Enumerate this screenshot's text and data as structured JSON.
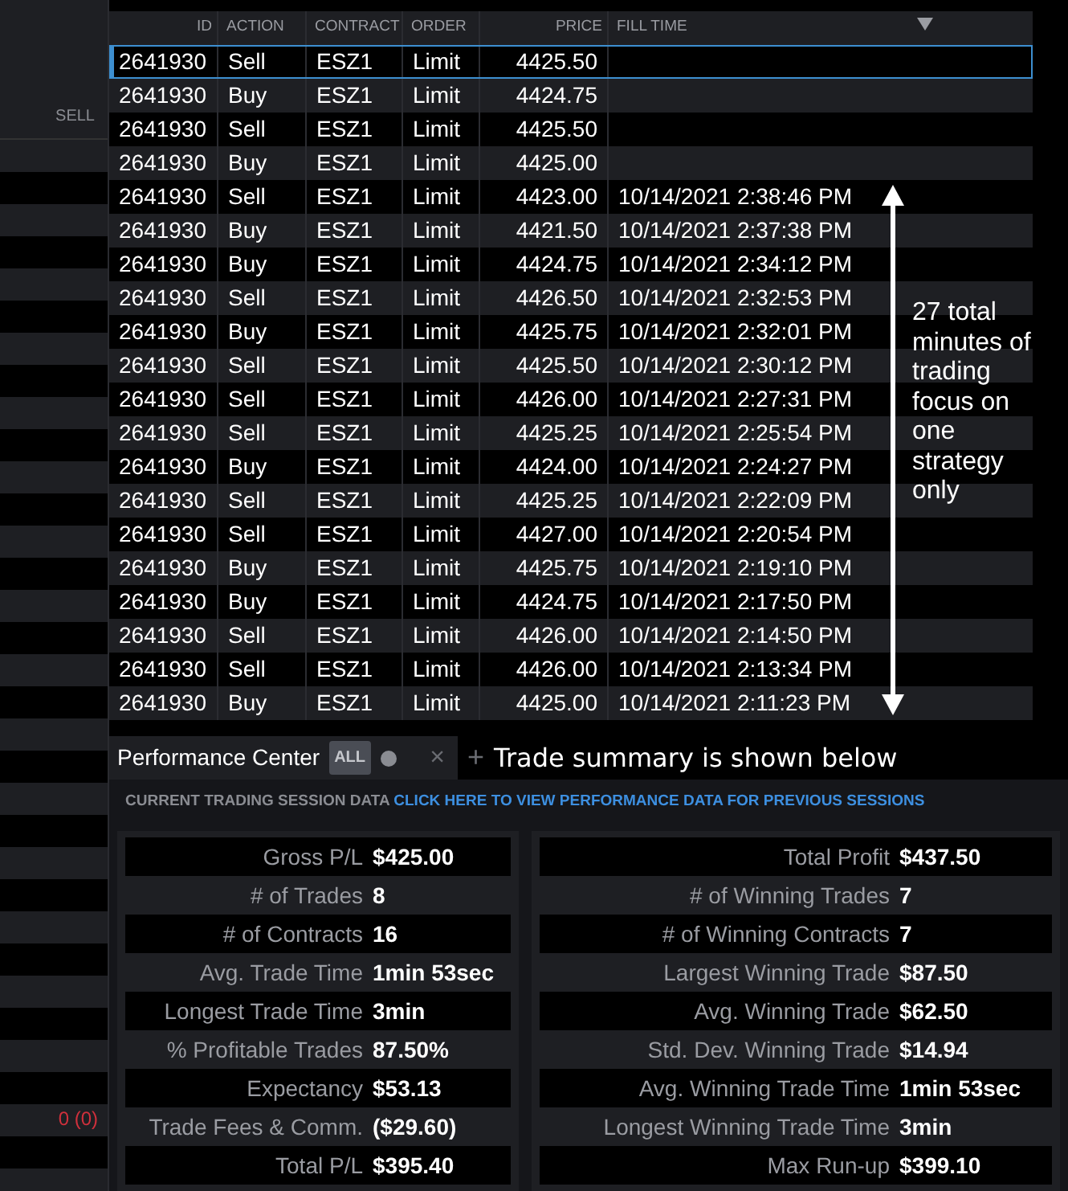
{
  "side_panel": {
    "column_label": "SELL",
    "position_value": "0 (0)"
  },
  "orders": {
    "columns": [
      "ID",
      "ACTION",
      "CONTRACT",
      "ORDER",
      "PRICE",
      "FILL TIME"
    ],
    "rows": [
      {
        "id": "2641930",
        "action": "Sell",
        "contract": "ESZ1",
        "order": "Limit",
        "price": "4425.50",
        "selected": true
      },
      {
        "id": "2641930",
        "action": "Buy",
        "contract": "ESZ1",
        "order": "Limit",
        "price": "4424.75",
        "selected": false
      },
      {
        "id": "2641930",
        "action": "Sell",
        "contract": "ESZ1",
        "order": "Limit",
        "price": "4425.50",
        "selected": false
      },
      {
        "id": "2641930",
        "action": "Buy",
        "contract": "ESZ1",
        "order": "Limit",
        "price": "4425.00",
        "selected": false
      },
      {
        "id": "2641930",
        "action": "Sell",
        "contract": "ESZ1",
        "order": "Limit",
        "price": "4423.00",
        "fill_time": "10/14/2021 2:38:46 PM",
        "selected": false
      },
      {
        "id": "2641930",
        "action": "Buy",
        "contract": "ESZ1",
        "order": "Limit",
        "price": "4421.50",
        "fill_time": "10/14/2021 2:37:38 PM",
        "selected": false
      },
      {
        "id": "2641930",
        "action": "Buy",
        "contract": "ESZ1",
        "order": "Limit",
        "price": "4424.75",
        "fill_time": "10/14/2021 2:34:12 PM",
        "selected": false
      },
      {
        "id": "2641930",
        "action": "Sell",
        "contract": "ESZ1",
        "order": "Limit",
        "price": "4426.50",
        "fill_time": "10/14/2021 2:32:53 PM",
        "selected": false
      },
      {
        "id": "2641930",
        "action": "Buy",
        "contract": "ESZ1",
        "order": "Limit",
        "price": "4425.75",
        "fill_time": "10/14/2021 2:32:01 PM",
        "selected": false
      },
      {
        "id": "2641930",
        "action": "Sell",
        "contract": "ESZ1",
        "order": "Limit",
        "price": "4425.50",
        "fill_time": "10/14/2021 2:30:12 PM",
        "selected": false
      },
      {
        "id": "2641930",
        "action": "Sell",
        "contract": "ESZ1",
        "order": "Limit",
        "price": "4426.00",
        "fill_time": "10/14/2021 2:27:31 PM",
        "selected": false
      },
      {
        "id": "2641930",
        "action": "Sell",
        "contract": "ESZ1",
        "order": "Limit",
        "price": "4425.25",
        "fill_time": "10/14/2021 2:25:54 PM",
        "selected": false
      },
      {
        "id": "2641930",
        "action": "Buy",
        "contract": "ESZ1",
        "order": "Limit",
        "price": "4424.00",
        "fill_time": "10/14/2021 2:24:27 PM",
        "selected": false
      },
      {
        "id": "2641930",
        "action": "Sell",
        "contract": "ESZ1",
        "order": "Limit",
        "price": "4425.25",
        "fill_time": "10/14/2021 2:22:09 PM",
        "selected": false
      },
      {
        "id": "2641930",
        "action": "Sell",
        "contract": "ESZ1",
        "order": "Limit",
        "price": "4427.00",
        "fill_time": "10/14/2021 2:20:54 PM",
        "selected": false
      },
      {
        "id": "2641930",
        "action": "Buy",
        "contract": "ESZ1",
        "order": "Limit",
        "price": "4425.75",
        "fill_time": "10/14/2021 2:19:10 PM",
        "selected": false
      },
      {
        "id": "2641930",
        "action": "Buy",
        "contract": "ESZ1",
        "order": "Limit",
        "price": "4424.75",
        "fill_time": "10/14/2021 2:17:50 PM",
        "selected": false
      },
      {
        "id": "2641930",
        "action": "Sell",
        "contract": "ESZ1",
        "order": "Limit",
        "price": "4426.00",
        "fill_time": "10/14/2021 2:14:50 PM",
        "selected": false
      },
      {
        "id": "2641930",
        "action": "Sell",
        "contract": "ESZ1",
        "order": "Limit",
        "price": "4426.00",
        "fill_time": "10/14/2021 2:13:34 PM",
        "selected": false
      },
      {
        "id": "2641930",
        "action": "Buy",
        "contract": "ESZ1",
        "order": "Limit",
        "price": "4425.00",
        "fill_time": "10/14/2021 2:11:23 PM",
        "selected": false
      }
    ]
  },
  "annotation": {
    "text": "27 total minutes of trading focus on one strategy only"
  },
  "performance": {
    "tab": {
      "title": "Performance Center",
      "badge": "ALL",
      "close": "×",
      "add": "+"
    },
    "caption": "Trade summary is shown below",
    "session_label": "CURRENT TRADING SESSION DATA",
    "previous_link": "CLICK HERE TO VIEW PERFORMANCE DATA FOR PREVIOUS SESSIONS",
    "left_stats": [
      {
        "label": "Gross P/L",
        "value": "$425.00"
      },
      {
        "label": "# of Trades",
        "value": "8"
      },
      {
        "label": "# of Contracts",
        "value": "16"
      },
      {
        "label": "Avg. Trade Time",
        "value": "1min 53sec"
      },
      {
        "label": "Longest Trade Time",
        "value": "3min"
      },
      {
        "label": "% Profitable Trades",
        "value": "87.50%"
      },
      {
        "label": "Expectancy",
        "value": "$53.13"
      },
      {
        "label": "Trade Fees & Comm.",
        "value": "($29.60)"
      },
      {
        "label": "Total P/L",
        "value": "$395.40"
      }
    ],
    "right_stats": [
      {
        "label": "Total Profit",
        "value": "$437.50"
      },
      {
        "label": "# of Winning Trades",
        "value": "7"
      },
      {
        "label": "# of Winning Contracts",
        "value": "7"
      },
      {
        "label": "Largest Winning Trade",
        "value": "$87.50"
      },
      {
        "label": "Avg. Winning Trade",
        "value": "$62.50"
      },
      {
        "label": "Std. Dev. Winning Trade",
        "value": "$14.94"
      },
      {
        "label": "Avg. Winning Trade Time",
        "value": "1min 53sec"
      },
      {
        "label": "Longest Winning Trade Time",
        "value": "3min"
      },
      {
        "label": "Max Run-up",
        "value": "$399.10"
      }
    ]
  }
}
